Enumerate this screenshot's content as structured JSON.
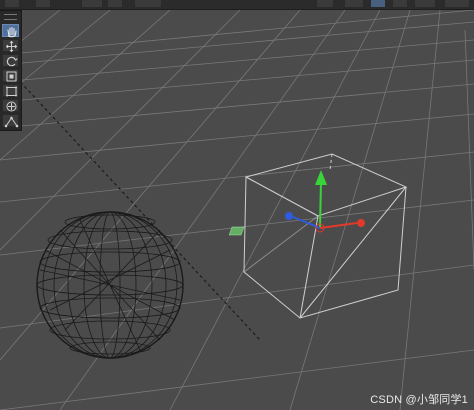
{
  "scene": {
    "objects": [
      "sphere-wireframe",
      "cube-wireframe-selected"
    ],
    "active_tool": "hand",
    "gizmo_axes": {
      "x_color": "#e23a2a",
      "y_color": "#39d43a",
      "z_color": "#2f5be0"
    }
  },
  "toolbox": {
    "tools": [
      {
        "name": "hand",
        "active": true
      },
      {
        "name": "move",
        "active": false
      },
      {
        "name": "rotate",
        "active": false
      },
      {
        "name": "scale",
        "active": false
      },
      {
        "name": "rect",
        "active": false
      },
      {
        "name": "transform",
        "active": false
      },
      {
        "name": "custom",
        "active": false
      }
    ]
  },
  "watermark": {
    "text": "CSDN @小邹同学1"
  },
  "colors": {
    "background": "#4b4b4b",
    "grid": "#7a7a7a",
    "selection": "#d0d0d0",
    "accent": "#4f6f9c"
  }
}
